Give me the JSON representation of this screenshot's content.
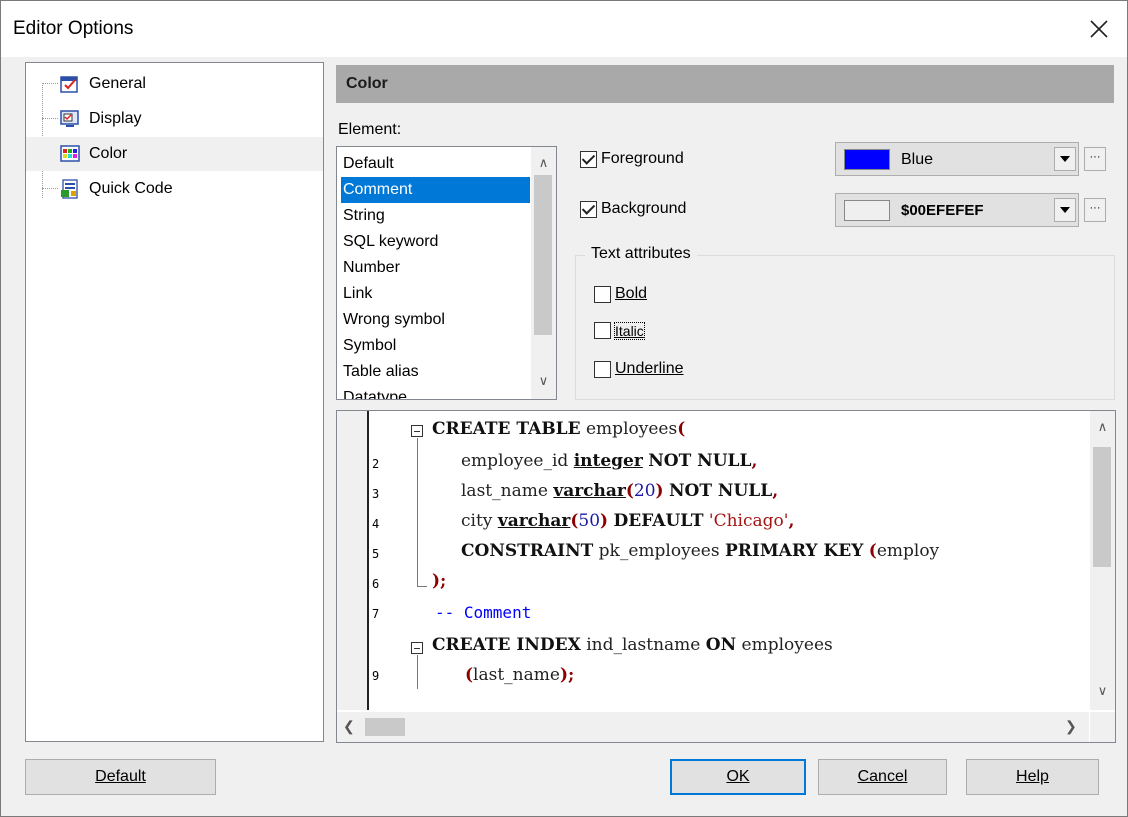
{
  "window": {
    "title": "Editor Options"
  },
  "tree": {
    "items": [
      {
        "label": "General",
        "icon": "general-icon"
      },
      {
        "label": "Display",
        "icon": "display-icon"
      },
      {
        "label": "Color",
        "icon": "color-icon",
        "selected": true
      },
      {
        "label": "Quick Code",
        "icon": "quick-code-icon"
      }
    ]
  },
  "section": {
    "title": "Color"
  },
  "element": {
    "label": "Element:",
    "items": [
      "Default",
      "Comment",
      "String",
      "SQL keyword",
      "Number",
      "Link",
      "Wrong symbol",
      "Symbol",
      "Table alias",
      "Datatype"
    ],
    "selected": "Comment"
  },
  "foreground": {
    "label": "Foreground",
    "checked": true,
    "value": "Blue",
    "color": "#0000ff"
  },
  "background": {
    "label": "Background",
    "checked": true,
    "value": "$00EFEFEF",
    "color": "#efefef"
  },
  "text_attributes": {
    "label": "Text attributes",
    "bold": {
      "label": "Bold",
      "checked": false
    },
    "italic": {
      "label": "Italic",
      "checked": false
    },
    "underline": {
      "label": "Underline",
      "checked": false
    }
  },
  "editor": {
    "line_numbers": [
      "2",
      "3",
      "4",
      "5",
      "6",
      "7",
      "9"
    ]
  },
  "buttons": {
    "default": "Default",
    "ok": "OK",
    "cancel": "Cancel",
    "help": "Help"
  }
}
